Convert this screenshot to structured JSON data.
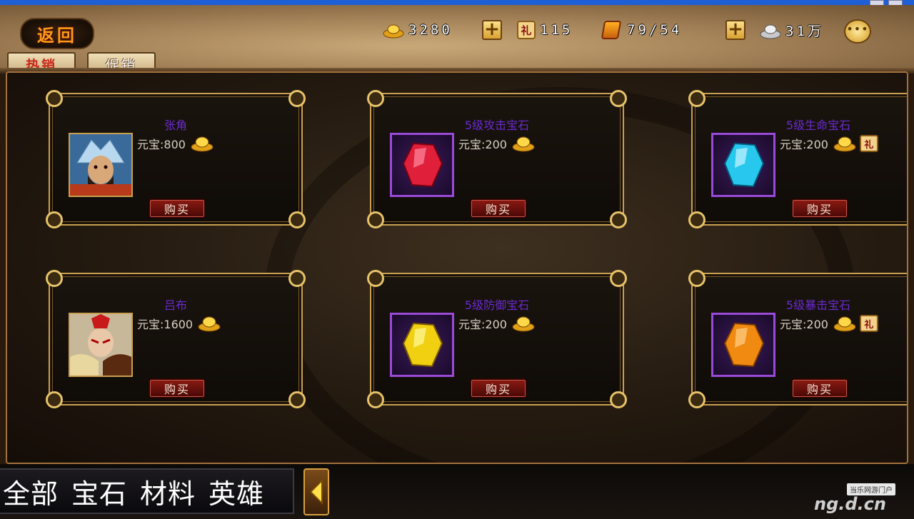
{
  "header": {
    "back_label": "返回",
    "gold": "3280",
    "gift_tokens": "115",
    "stamina": "79/54",
    "silver": "31万",
    "icons": {
      "gold": "gold-ingot-icon",
      "gift": "gift-token-icon",
      "stamina": "stamina-token-icon",
      "silver": "silver-ingot-icon",
      "chat": "chat-bubble-icon",
      "add": "plus-icon"
    }
  },
  "tabs": [
    {
      "label": "热销",
      "active": true
    },
    {
      "label": "促销",
      "active": false
    }
  ],
  "items": [
    {
      "name": "张角",
      "price_label": "元宝:800",
      "type": "hero",
      "gift": false
    },
    {
      "name": "5级攻击宝石",
      "price_label": "元宝:200",
      "type": "gem",
      "gem_color": "#e0203a",
      "gift": false
    },
    {
      "name": "5级生命宝石",
      "price_label": "元宝:200",
      "type": "gem",
      "gem_color": "#28c8ee",
      "gift": true
    },
    {
      "name": "吕布",
      "price_label": "元宝:1600",
      "type": "hero",
      "gift": false
    },
    {
      "name": "5级防御宝石",
      "price_label": "元宝:200",
      "type": "gem",
      "gem_color": "#f0d010",
      "gift": false
    },
    {
      "name": "5级暴击宝石",
      "price_label": "元宝:200",
      "type": "gem",
      "gem_color": "#f08a10",
      "gift": true
    }
  ],
  "buy_label": "购买",
  "gift_glyph": "礼",
  "filters": [
    "全部",
    "宝石",
    "材料",
    "英雄"
  ],
  "watermark": {
    "tag": "当乐网游门户",
    "logo": "ng.d.cn"
  },
  "colors": {
    "item_name": "#6a2ad0",
    "frame_gold": "#c8a050",
    "buy_button": "#8a1a12"
  }
}
